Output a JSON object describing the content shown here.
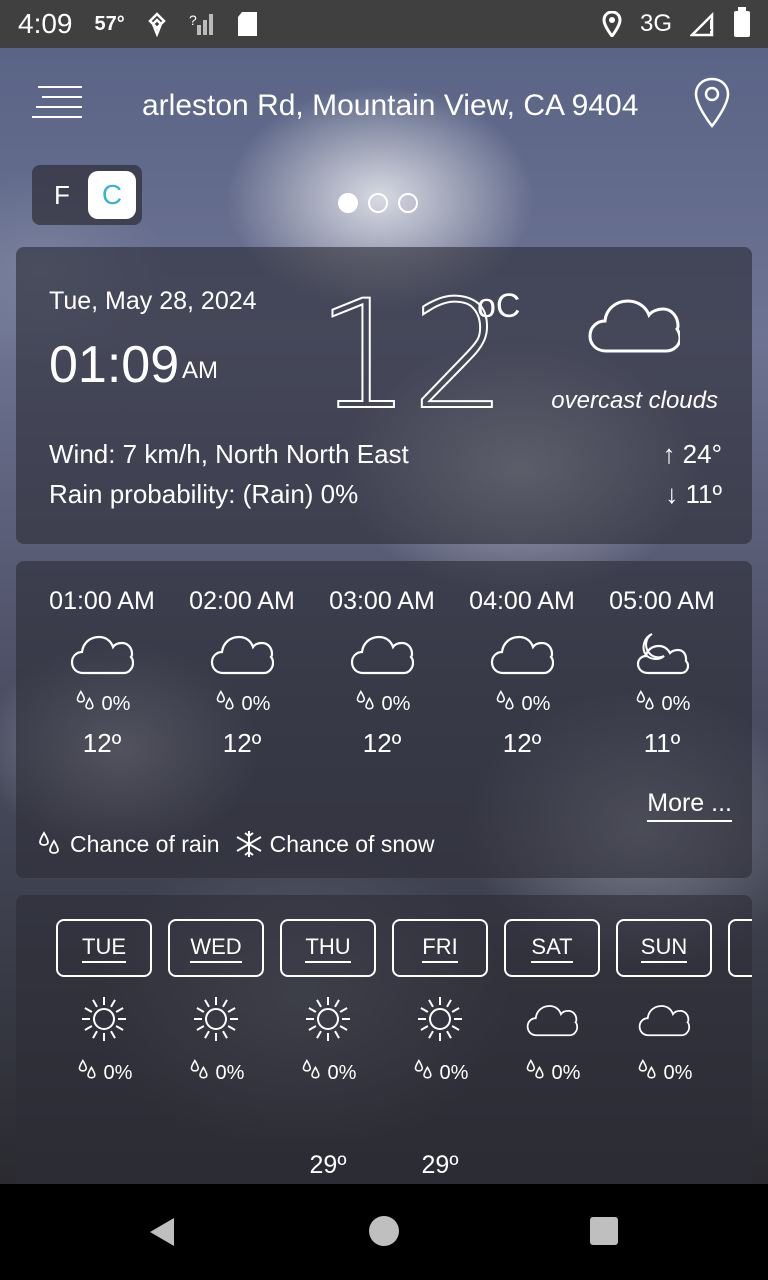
{
  "status_bar": {
    "time": "4:09",
    "temp": "57°",
    "network": "3G"
  },
  "header": {
    "location": "arleston Rd, Mountain View, CA 9404"
  },
  "unit_toggle": {
    "f_label": "F",
    "c_label": "C",
    "selected": "C"
  },
  "current": {
    "date": "Tue, May 28, 2024",
    "time": "01:09",
    "ampm": "AM",
    "temperature": "12",
    "unit": "oC",
    "description": "overcast clouds",
    "wind": "Wind: 7 km/h, North North East",
    "rain": "Rain probability: (Rain) 0%",
    "high": "↑ 24°",
    "low": "↓ 11º"
  },
  "hourly": [
    {
      "time": "01:00 AM",
      "icon": "cloud-icon",
      "rain": "0%",
      "temp": "12º"
    },
    {
      "time": "02:00 AM",
      "icon": "cloud-icon",
      "rain": "0%",
      "temp": "12º"
    },
    {
      "time": "03:00 AM",
      "icon": "cloud-icon",
      "rain": "0%",
      "temp": "12º"
    },
    {
      "time": "04:00 AM",
      "icon": "cloud-icon",
      "rain": "0%",
      "temp": "12º"
    },
    {
      "time": "05:00 AM",
      "icon": "moon-cloud-icon",
      "rain": "0%",
      "temp": "11º"
    }
  ],
  "hourly_more": "More ...",
  "legend": {
    "rain": "Chance of rain",
    "snow": "Chance of snow"
  },
  "daily": [
    {
      "day": "TUE",
      "icon": "sun-icon",
      "rain": "0%",
      "high": ""
    },
    {
      "day": "WED",
      "icon": "sun-icon",
      "rain": "0%",
      "high": ""
    },
    {
      "day": "THU",
      "icon": "sun-icon",
      "rain": "0%",
      "high": "29º"
    },
    {
      "day": "FRI",
      "icon": "sun-icon",
      "rain": "0%",
      "high": "29º"
    },
    {
      "day": "SAT",
      "icon": "cloud-icon",
      "rain": "0%",
      "high": ""
    },
    {
      "day": "SUN",
      "icon": "cloud-icon",
      "rain": "0%",
      "high": ""
    }
  ]
}
